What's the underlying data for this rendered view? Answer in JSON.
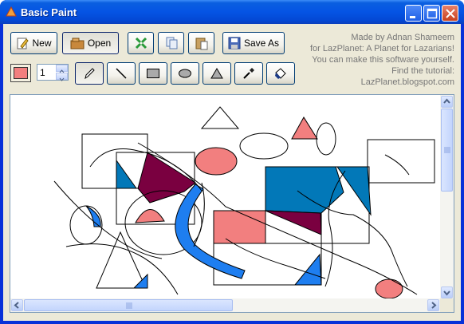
{
  "window": {
    "title": "Basic Paint"
  },
  "toolbar": {
    "new_label": "New",
    "open_label": "Open",
    "saveas_label": "Save As",
    "pen_width": "1",
    "current_color": "#f27f7f"
  },
  "credits": {
    "line1": "Made by Adnan Shameem",
    "line2": "for LazPlanet: A Planet for Lazarians!",
    "line3": "You can make this software yourself.",
    "line4": "Find the tutorial:",
    "line5": "LazPlanet.blogspot.com"
  },
  "tools": {
    "icons": [
      "pencil-icon",
      "line-icon",
      "rectangle-icon",
      "ellipse-icon",
      "triangle-icon",
      "color-picker-icon",
      "fill-bucket-icon"
    ],
    "selected": "pencil"
  },
  "colors": {
    "fill_red": "#f27f7f",
    "fill_blue": "#0278b8",
    "fill_bright_blue": "#1e7ef0",
    "fill_maroon": "#7a0040"
  }
}
